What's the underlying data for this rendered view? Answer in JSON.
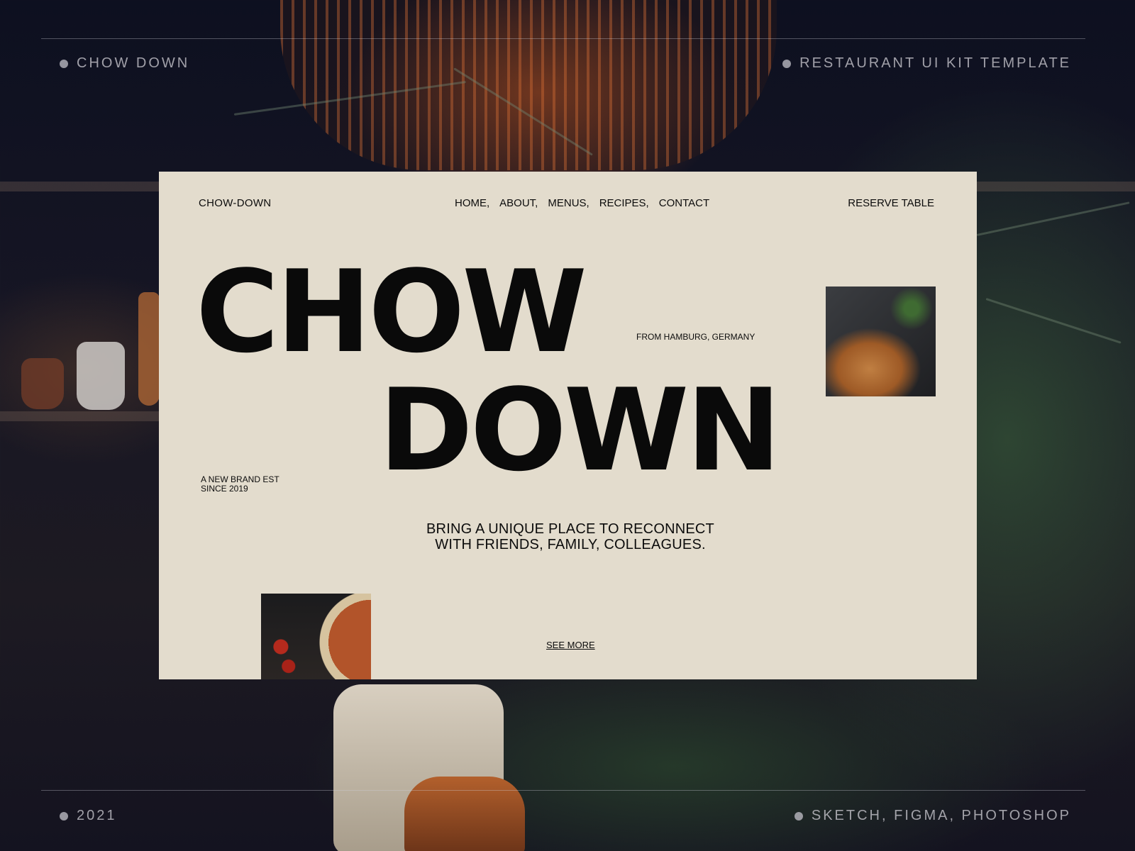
{
  "frame": {
    "top_left": "CHOW DOWN",
    "top_right": "RESTAURANT UI KIT TEMPLATE",
    "bottom_left": "2021",
    "bottom_right": "SKETCH, FIGMA, PHOTOSHOP"
  },
  "card": {
    "brand": "CHOW-DOWN",
    "nav": [
      "HOME,",
      "ABOUT,",
      "MENUS,",
      "RECIPES,",
      "CONTACT"
    ],
    "reserve_label": "RESERVE TABLE",
    "hero_line_1": "CHOW",
    "hero_line_2": "DOWN",
    "location": "FROM HAMBURG, GERMANY",
    "established": "A NEW BRAND EST SINCE 2019",
    "tagline": "BRING A UNIQUE PLACE TO RECONNECT WITH FRIENDS, FAMILY, COLLEAGUES.",
    "see_more_label": "SEE MORE"
  },
  "colors": {
    "card_background": "#e3dccd",
    "text": "#0c0c0c"
  }
}
